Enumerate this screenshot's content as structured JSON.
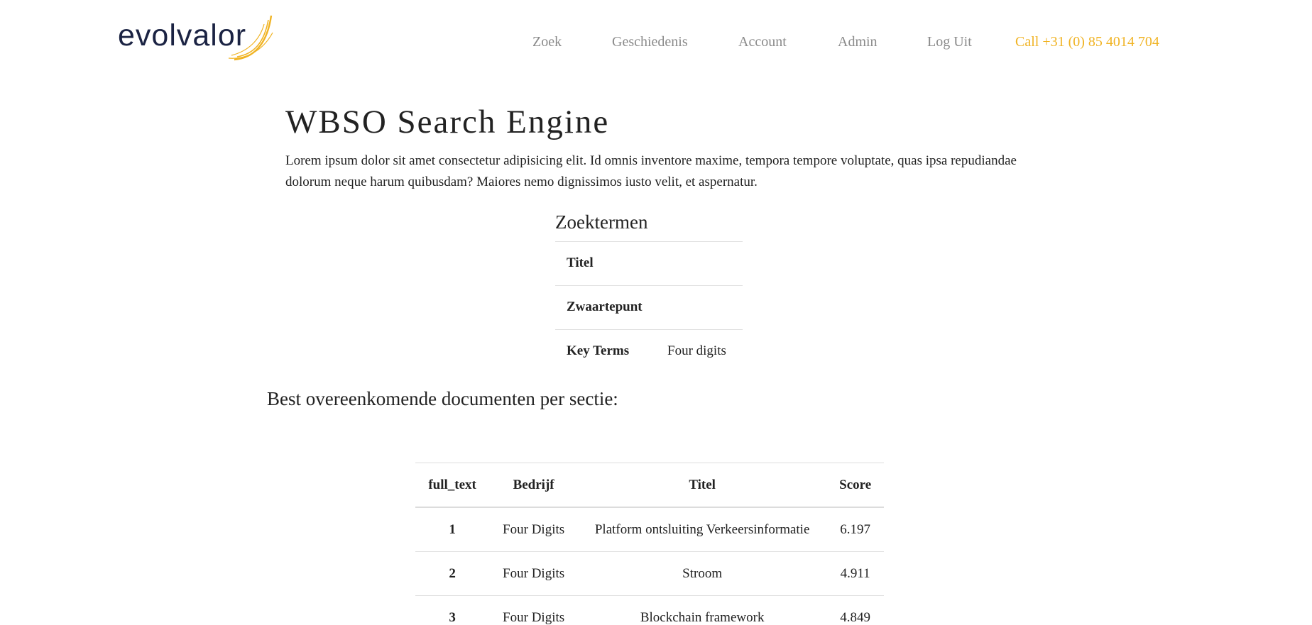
{
  "brand": {
    "name": "evolvalor",
    "accent_color": "#f0b323",
    "text_color": "#1b2343"
  },
  "nav": {
    "items": [
      "Zoek",
      "Geschiedenis",
      "Account",
      "Admin",
      "Log Uit"
    ],
    "call": "Call +31 (0) 85 4014 704"
  },
  "main": {
    "title": "WBSO Search Engine",
    "intro": "Lorem ipsum dolor sit amet consectetur adipisicing elit. Id omnis inventore maxime, tempora tempore voluptate, quas ipsa repudiandae dolorum neque harum quibusdam? Maiores nemo dignissimos iusto velit, et aspernatur."
  },
  "search_terms": {
    "title": "Zoektermen",
    "rows": [
      {
        "key": "Titel",
        "value": ""
      },
      {
        "key": "Zwaartepunt",
        "value": ""
      },
      {
        "key": "Key Terms",
        "value": "Four digits"
      }
    ]
  },
  "results": {
    "heading": "Best overeenkomende documenten per sectie:",
    "columns": [
      "full_text",
      "Bedrijf",
      "Titel",
      "Score"
    ],
    "rows": [
      {
        "idx": "1",
        "bedrijf": "Four Digits",
        "titel": "Platform ontsluiting Verkeersinformatie",
        "score": "6.197"
      },
      {
        "idx": "2",
        "bedrijf": "Four Digits",
        "titel": "Stroom",
        "score": "4.911"
      },
      {
        "idx": "3",
        "bedrijf": "Four Digits",
        "titel": "Blockchain framework",
        "score": "4.849"
      }
    ]
  }
}
